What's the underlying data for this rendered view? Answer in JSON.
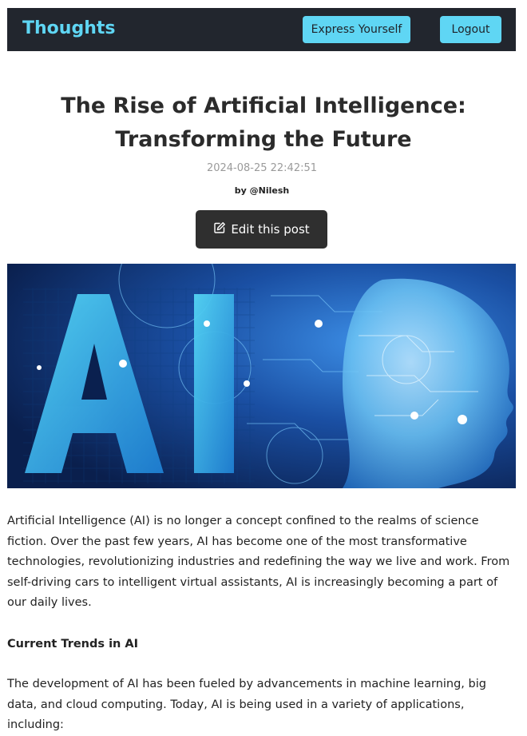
{
  "header": {
    "brand": "Thoughts",
    "express_label": "Express Yourself",
    "logout_label": "Logout"
  },
  "post": {
    "title": "The Rise of Artificial Intelligence: Transforming the Future",
    "date": "2024-08-25 22:42:51",
    "author": "by @Nilesh",
    "edit_label": "Edit this post",
    "image_text": "AI",
    "paragraph1": "Artificial Intelligence (AI) is no longer a concept confined to the realms of science fiction. Over the past few years, AI has become one of the most transformative technologies, revolutionizing industries and redefining the way we live and work. From self-driving cars to intelligent virtual assistants, AI is increasingly becoming a part of our daily lives.",
    "section_heading": "Current Trends in AI",
    "paragraph2": "The development of AI has been fueled by advancements in machine learning, big data, and cloud computing. Today, AI is being used in a variety of applications, including:"
  },
  "colors": {
    "navbar_bg": "#22262e",
    "accent": "#5fd6f4",
    "edit_button_bg": "#2f2f2f"
  },
  "icons": {
    "edit": "pencil-square-icon"
  }
}
